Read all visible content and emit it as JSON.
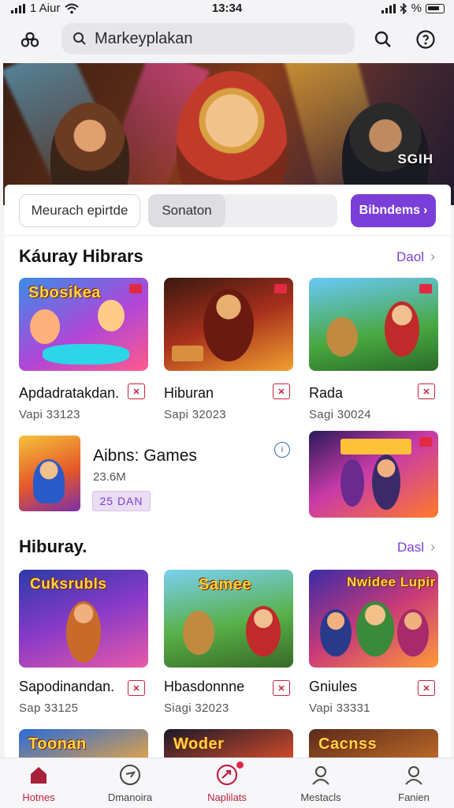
{
  "status_bar": {
    "carrier": "1 Aiur",
    "time": "13:34"
  },
  "header": {
    "search_placeholder": "Markeyplakan"
  },
  "hero": {
    "badge": "SGIH"
  },
  "filters": {
    "chip_outline": "Meurach epirtde",
    "chip_gray": "Sonaton",
    "chip_primary": "Bibndems"
  },
  "section1": {
    "title": "Káuray Hibrars",
    "see_all": "Daol",
    "cards": [
      {
        "name": "Apdadratakdan.",
        "meta": "Vapi 33123",
        "art": "Sbosikea"
      },
      {
        "name": "Hiburan",
        "meta": "Sapi 32023",
        "art": ""
      },
      {
        "name": "Rada",
        "meta": "Sagi 30024",
        "art": ""
      }
    ],
    "wide_item": {
      "title": "Aibns: Games",
      "size": "23.6M",
      "pill": "25 DAN"
    }
  },
  "section2": {
    "title": "Hiburay.",
    "see_all": "Dasl",
    "cards": [
      {
        "name": "Sapodinandan.",
        "meta": "Sap 33125",
        "art": "Cuksrubls"
      },
      {
        "name": "Hbasdonnne",
        "meta": "Siagi 32023",
        "art": "Samee"
      },
      {
        "name": "Gniules",
        "meta": "Vapi 33331",
        "art": "Nwidee Lupir"
      }
    ],
    "peek_art": [
      "Toonan",
      "Woder",
      "Cacnss"
    ]
  },
  "bottom_nav": [
    {
      "label": "Hotnes"
    },
    {
      "label": "Dmanoira"
    },
    {
      "label": "Naplilats"
    },
    {
      "label": "Mestacls"
    },
    {
      "label": "Fanien"
    }
  ],
  "colors": {
    "accent": "#7a3fd8",
    "brand_red": "#c0203e",
    "badge_red": "#c8203a"
  },
  "icons": [
    "logo-icon",
    "search-icon",
    "info-icon",
    "home-icon",
    "compass-icon",
    "apps-icon",
    "user-icon",
    "profile-icon",
    "wifi-icon",
    "bluetooth-icon",
    "battery-icon"
  ]
}
